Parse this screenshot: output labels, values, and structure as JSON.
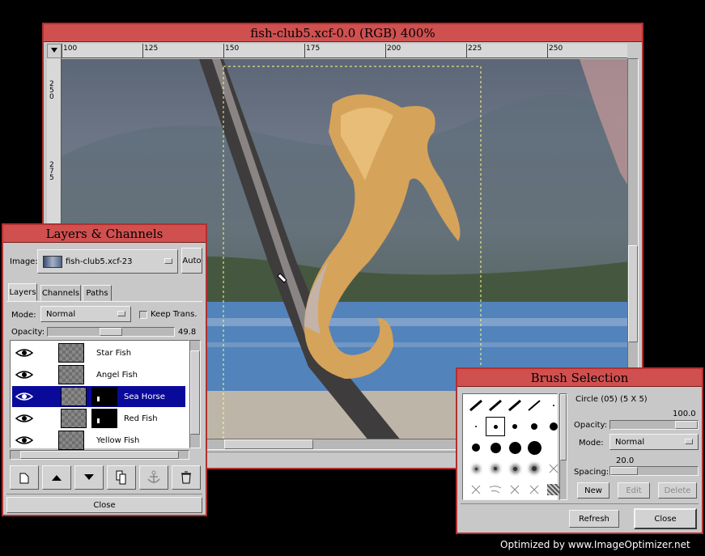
{
  "image_window": {
    "title": "fish-club5.xcf-0.0 (RGB) 400%",
    "ruler_h": [
      "100",
      "125",
      "150",
      "175",
      "200",
      "225",
      "250"
    ],
    "ruler_v": [
      "250",
      "275"
    ]
  },
  "layers_window": {
    "title": "Layers & Channels",
    "image_label": "Image:",
    "image_value": "fish-club5.xcf-23",
    "auto_label": "Auto",
    "tabs": [
      "Layers",
      "Channels",
      "Paths"
    ],
    "mode_label": "Mode:",
    "mode_value": "Normal",
    "keep_trans_label": "Keep Trans.",
    "opacity_label": "Opacity:",
    "opacity_value": "49.8",
    "opacity_fraction": 0.498,
    "layers": [
      {
        "name": "Star Fish",
        "selected": false,
        "mask": false
      },
      {
        "name": "Angel Fish",
        "selected": false,
        "mask": false
      },
      {
        "name": "Sea Horse",
        "selected": true,
        "mask": true
      },
      {
        "name": "Red Fish",
        "selected": false,
        "mask": true
      },
      {
        "name": "Yellow Fish",
        "selected": false,
        "mask": false
      }
    ],
    "toolbar_icons": [
      "new-layer-icon",
      "raise-layer-icon",
      "lower-layer-icon",
      "duplicate-layer-icon",
      "anchor-layer-icon",
      "delete-layer-icon"
    ],
    "close_label": "Close"
  },
  "brush_window": {
    "title": "Brush Selection",
    "brush_name": "Circle (05)  (5 X 5)",
    "opacity_label": "Opacity:",
    "opacity_value": "100.0",
    "mode_label": "Mode:",
    "mode_value": "Normal",
    "spacing_label": "Spacing:",
    "spacing_value": "20.0",
    "new_label": "New",
    "edit_label": "Edit",
    "delete_label": "Delete",
    "refresh_label": "Refresh",
    "close_label": "Close"
  },
  "footer": {
    "text": "Optimized by www.ImageOptimizer.net"
  },
  "colors": {
    "title_bar": "#d05050",
    "window_bg": "#c8c8c8",
    "selection": "#0a0a9a"
  }
}
